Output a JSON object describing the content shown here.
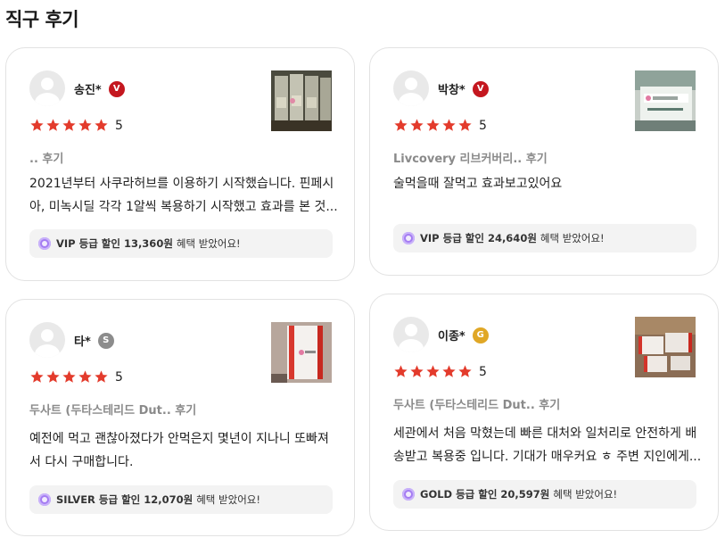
{
  "page": {
    "title": "직구 후기"
  },
  "colors": {
    "star": "#e33b2c",
    "vip_badge": "#c4171f",
    "silver_badge": "#8c8c8c",
    "gold_badge": "#e0a726",
    "coin": "#a47cf2"
  },
  "reviews": [
    {
      "author": "송진*",
      "badge": "V",
      "rating": 5,
      "rating_label": "5",
      "product": ".. 후기",
      "text_lines": [
        "2021년부터 사쿠라허브를 이용하기 시작했습니다. 핀페시",
        "아, 미녹시딜 각각 1알씩 복용하기 시작했고 효과를 본 것..."
      ],
      "benefit": {
        "grade_discount": "VIP 등급 할인 13,360원",
        "suffix": "혜택 받았어요!"
      }
    },
    {
      "author": "박창*",
      "badge": "V",
      "rating": 5,
      "rating_label": "5",
      "product": "Livcovery 리브커버리.. 후기",
      "text_lines": [
        "술먹을때 잘먹고 효과보고있어요"
      ],
      "benefit": {
        "grade_discount": "VIP 등급 할인 24,640원",
        "suffix": "혜택 받았어요!"
      }
    },
    {
      "author": "타*",
      "badge": "S",
      "rating": 5,
      "rating_label": "5",
      "product": "두사트 (두타스테리드 Dut.. 후기",
      "text_lines": [
        "예전에 먹고 괜찮아졌다가 안먹은지 몇년이 지나니 또빠져",
        "서 다시 구매합니다."
      ],
      "benefit": {
        "grade_discount": "SILVER 등급 할인 12,070원",
        "suffix": "혜택 받았어요!"
      }
    },
    {
      "author": "이종*",
      "badge": "G",
      "rating": 5,
      "rating_label": "5",
      "product": "두사트 (두타스테리드 Dut.. 후기",
      "text_lines": [
        "세관에서 처음 막혔는데 빠른 대처와 일처리로 안전하게 배",
        "송받고 복용중 입니다. 기대가 매우커요 ㅎ 주변 지인에게..."
      ],
      "benefit": {
        "grade_discount": "GOLD 등급 할인 20,597원",
        "suffix": "혜택 받았어요!"
      }
    }
  ]
}
